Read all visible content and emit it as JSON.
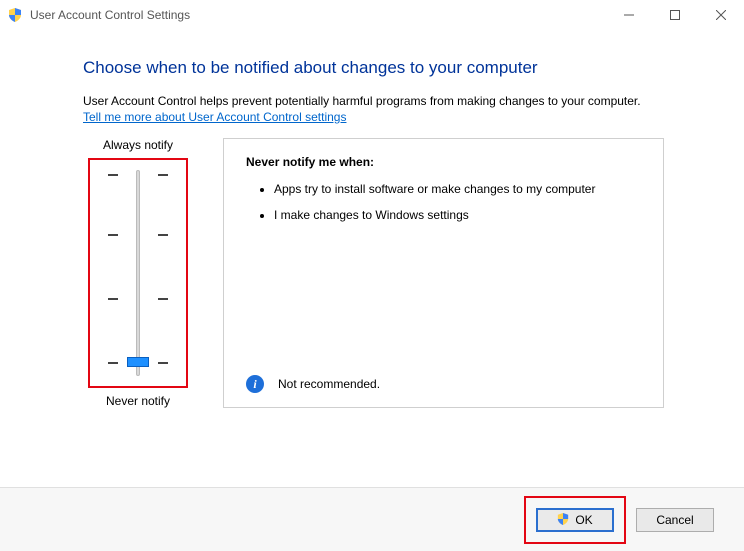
{
  "window": {
    "title": "User Account Control Settings"
  },
  "heading": "Choose when to be notified about changes to your computer",
  "subtext": "User Account Control helps prevent potentially harmful programs from making changes to your computer.",
  "help_link": "Tell me more about User Account Control settings",
  "slider": {
    "top_label": "Always notify",
    "bottom_label": "Never notify",
    "levels": 4,
    "current_level_index": 3
  },
  "description": {
    "heading": "Never notify me when:",
    "bullets": [
      "Apps try to install software or make changes to my computer",
      "I make changes to Windows settings"
    ],
    "recommendation": "Not recommended."
  },
  "buttons": {
    "ok": "OK",
    "cancel": "Cancel"
  }
}
